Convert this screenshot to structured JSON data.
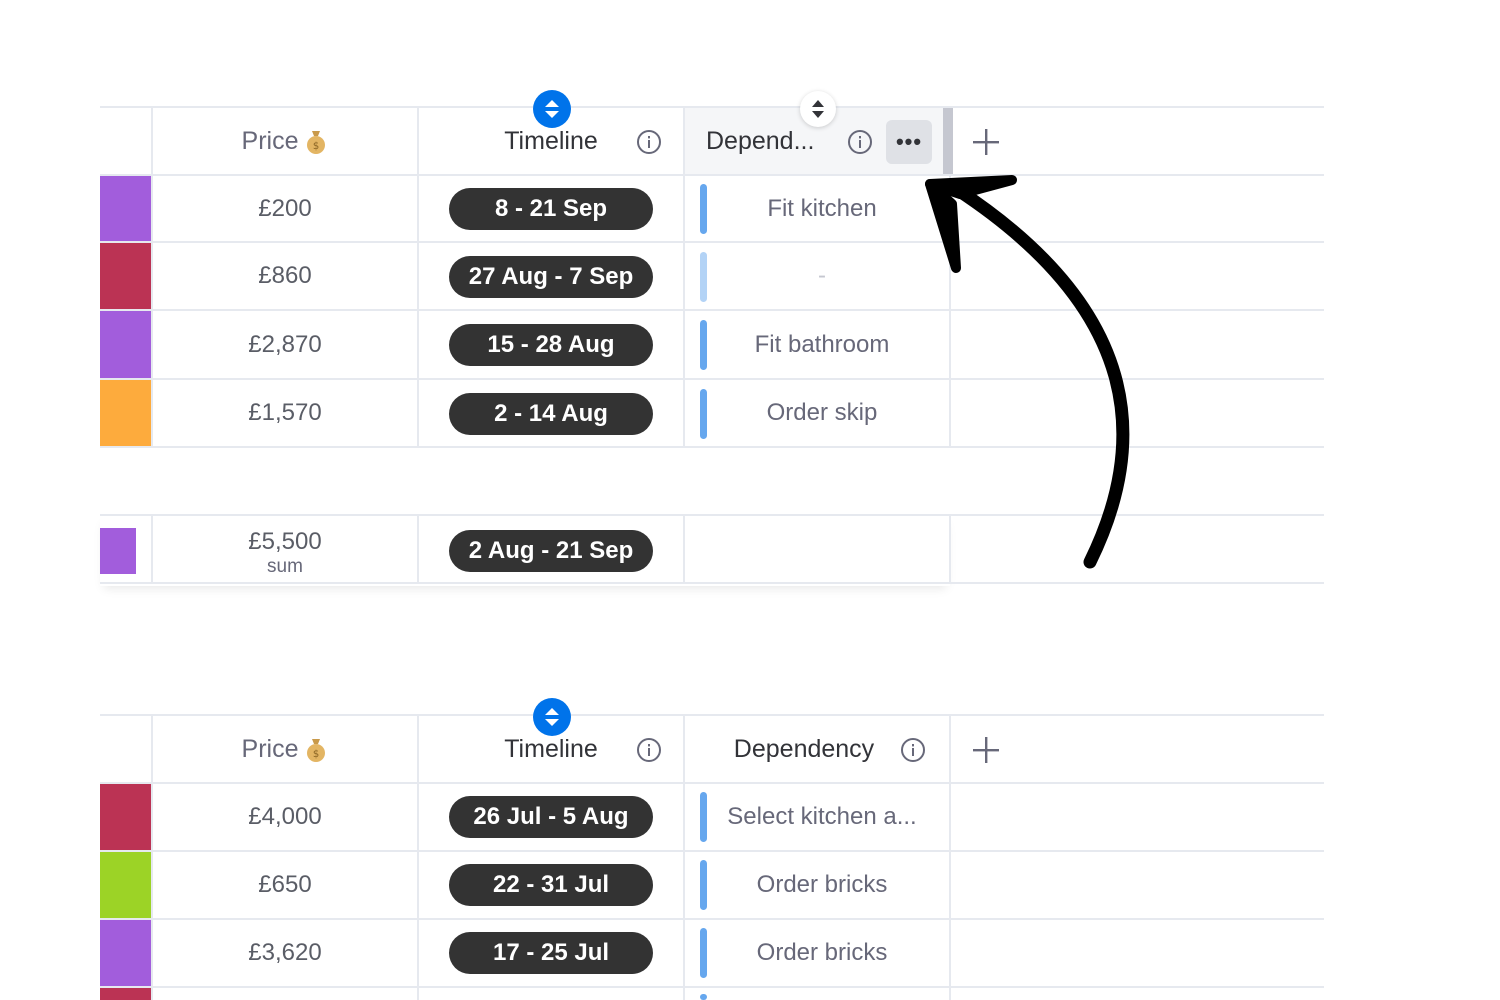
{
  "colors": {
    "purple": "#a25ddc",
    "red": "#bb3354",
    "orange": "#fdab3d",
    "lime": "#9cd326",
    "pill": "#333333",
    "accent": "#0073ea",
    "dependency_bar": "#66a7ee"
  },
  "table_top": {
    "headers": {
      "price": "Price",
      "timeline": "Timeline",
      "dependency": "Depend...",
      "more": "•••"
    },
    "rows": [
      {
        "price": "£200",
        "timeline": "8 - 21 Sep",
        "dependency": "Fit kitchen"
      },
      {
        "price": "£860",
        "timeline": "27 Aug - 7 Sep",
        "dependency": "-"
      },
      {
        "price": "£2,870",
        "timeline": "15 - 28 Aug",
        "dependency": "Fit bathroom"
      },
      {
        "price": "£1,570",
        "timeline": "2 - 14 Aug",
        "dependency": "Order skip"
      }
    ],
    "summary": {
      "price": "£5,500",
      "price_label": "sum",
      "timeline": "2 Aug - 21 Sep"
    }
  },
  "table_bottom": {
    "headers": {
      "price": "Price",
      "timeline": "Timeline",
      "dependency": "Dependency"
    },
    "rows": [
      {
        "price": "£4,000",
        "timeline": "26 Jul - 5 Aug",
        "dependency": "Select kitchen a..."
      },
      {
        "price": "£650",
        "timeline": "22 - 31 Jul",
        "dependency": "Order bricks"
      },
      {
        "price": "£3,620",
        "timeline": "17 - 25 Jul",
        "dependency": "Order bricks"
      }
    ]
  },
  "icons": {
    "money_bag": "money-bag-icon",
    "info": "info-icon",
    "sort": "sort-arrows-icon",
    "plus": "plus-icon",
    "more": "more-dots-icon",
    "arrow": "curved-arrow-icon"
  }
}
